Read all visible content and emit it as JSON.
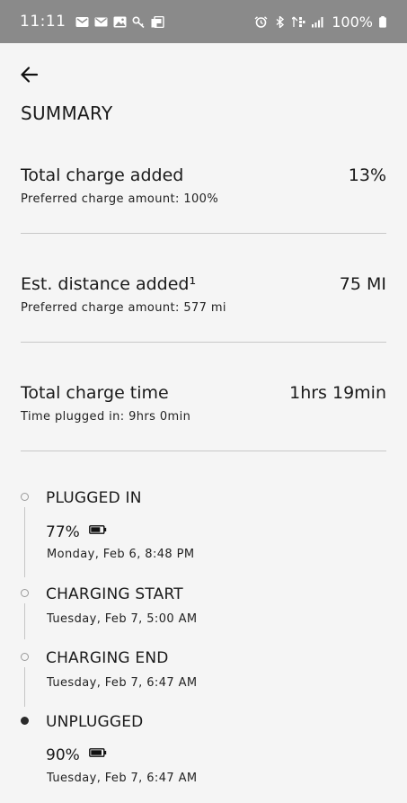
{
  "status_bar": {
    "time": "11:11",
    "battery_text": "100%",
    "left_icons": [
      "voicemail-icon",
      "mail-icon",
      "image-icon",
      "key-icon",
      "device-icon"
    ],
    "right_icons": [
      "alarm-icon",
      "bluetooth-icon",
      "wifi-call-icon",
      "signal-icon",
      "battery-icon"
    ]
  },
  "header": {
    "back_icon": "arrow-left-icon",
    "title": "SUMMARY"
  },
  "metrics": [
    {
      "label": "Total charge added",
      "value": "13%",
      "sub": "Preferred charge amount: 100%"
    },
    {
      "label": "Est. distance added¹",
      "value": "75 MI",
      "sub": "Preferred charge amount: 577 mi"
    },
    {
      "label": "Total charge time",
      "value": "1hrs 19min",
      "sub": "Time plugged in: 9hrs 0min"
    }
  ],
  "timeline": [
    {
      "title": "PLUGGED IN",
      "percent": "77%",
      "battery_level": 0.77,
      "date": "Monday, Feb 6, 8:48 PM",
      "filled": false
    },
    {
      "title": "CHARGING START",
      "date": "Tuesday, Feb 7, 5:00 AM",
      "filled": false
    },
    {
      "title": "CHARGING END",
      "date": "Tuesday, Feb 7, 6:47 AM",
      "filled": false
    },
    {
      "title": "UNPLUGGED",
      "percent": "90%",
      "battery_level": 0.9,
      "date": "Tuesday, Feb 7, 6:47 AM",
      "filled": true
    }
  ]
}
